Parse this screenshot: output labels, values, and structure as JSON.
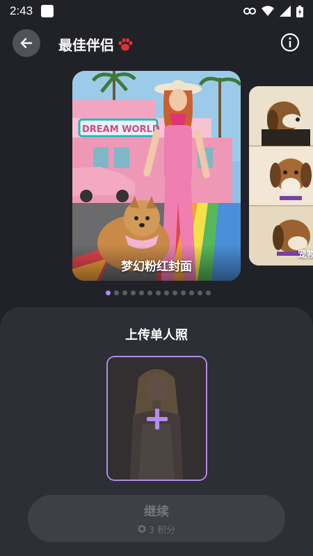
{
  "status_bar": {
    "time": "2:43"
  },
  "header": {
    "title": "最佳伴侣",
    "back_icon": "arrow-left-icon",
    "info_icon": "info-icon",
    "title_emoji_icon": "paw-icon"
  },
  "carousel": {
    "cards": [
      {
        "caption": "梦幻粉红封面",
        "sign_text": "DREAM WORLD"
      },
      {
        "caption": "宠物"
      }
    ],
    "page_count": 13,
    "active_index": 0
  },
  "upload": {
    "title": "上传单人照",
    "add_icon": "plus-icon"
  },
  "continue_button": {
    "label": "继续",
    "cost": "3 积分",
    "cost_icon": "credit-icon"
  },
  "colors": {
    "background": "#212228",
    "panel": "#2d2f36",
    "accent": "#b48cf0"
  }
}
